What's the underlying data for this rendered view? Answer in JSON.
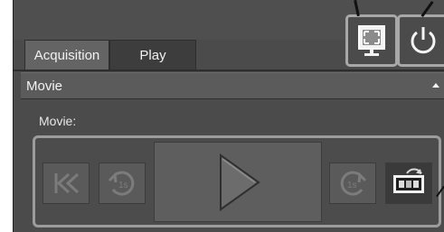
{
  "tabs": [
    {
      "label": "Acquisition"
    },
    {
      "label": "Play"
    }
  ],
  "section": {
    "title": "Movie"
  },
  "movie": {
    "label": "Movie:"
  },
  "controls": {
    "icons": [
      "skip-to-start-icon",
      "step-back-1s-icon",
      "play-icon",
      "step-forward-1s-icon",
      "export-movie-icon"
    ],
    "back_text": "1s",
    "forward_text": "1s"
  },
  "toolbar": {
    "icons": [
      "fullscreen-icon",
      "power-icon"
    ]
  }
}
